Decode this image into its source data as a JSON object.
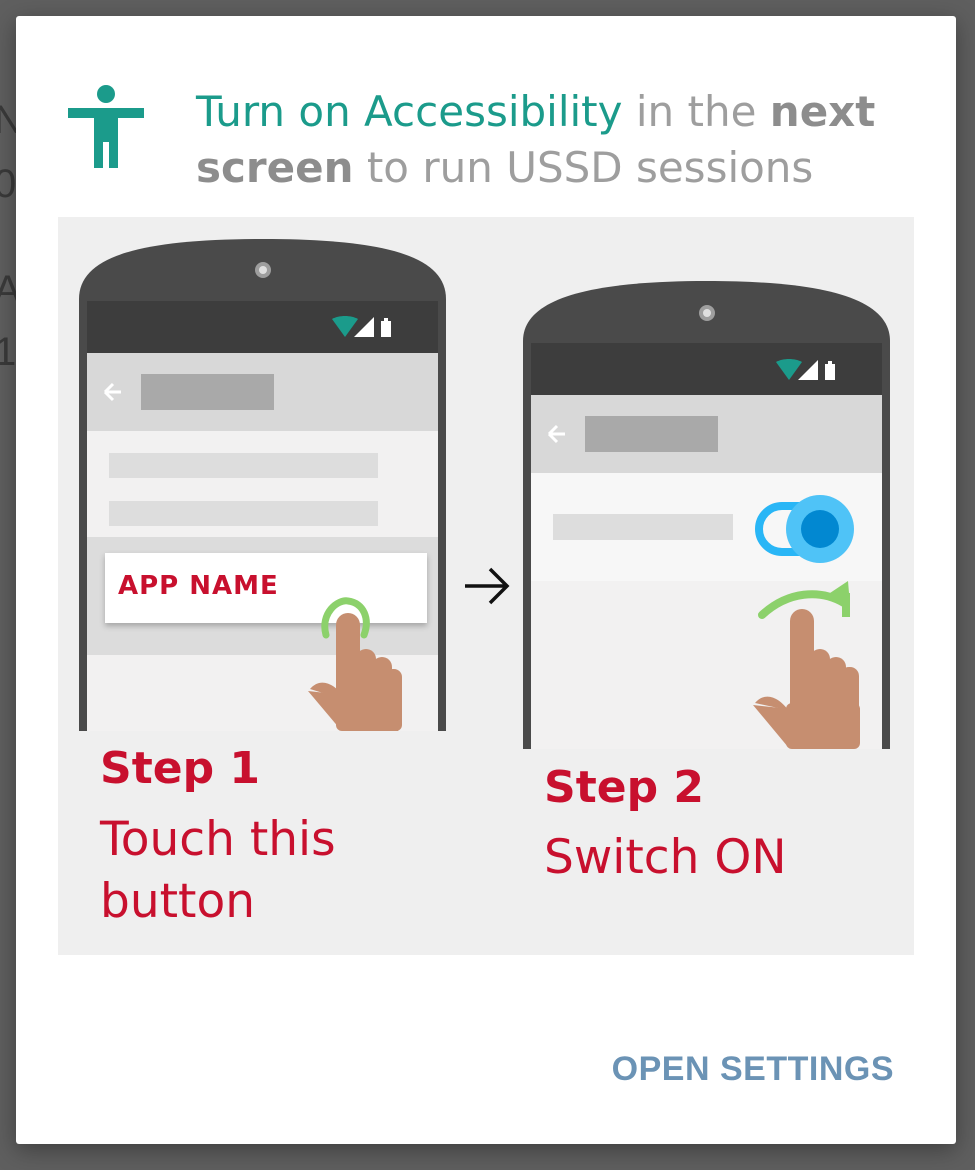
{
  "background": {
    "fragments": [
      "N",
      "0",
      "A",
      "1"
    ]
  },
  "dialog": {
    "icon": "accessibility-icon",
    "title": {
      "accent": "Turn on Accessibility",
      "part2": " in the ",
      "bold1": "next",
      "bold2": "screen",
      "part3": " to run USSD sessions"
    },
    "step1": {
      "title": "Step 1",
      "line1": "Touch this",
      "line2": "button",
      "app_label": "APP NAME"
    },
    "step2": {
      "title": "Step 2",
      "desc": "Switch ON"
    },
    "action_label": "OPEN SETTINGS"
  },
  "colors": {
    "accent": "#1b9b8b",
    "step_red": "#c8102e",
    "action_blue": "#6b93b5",
    "toggle_blue": "#29b6f6"
  }
}
